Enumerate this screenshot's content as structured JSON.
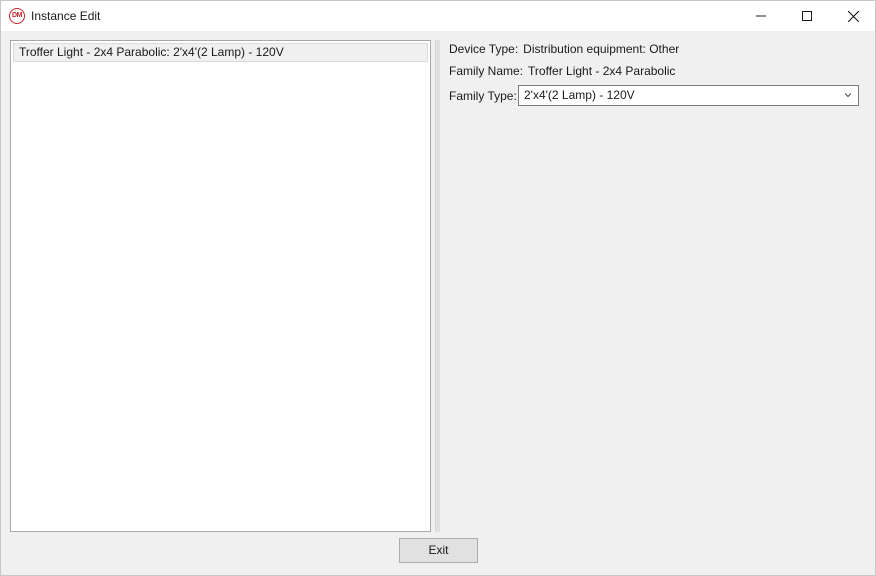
{
  "window": {
    "title": "Instance Edit",
    "app_icon_text": "DM"
  },
  "list": {
    "items": [
      {
        "label": "Troffer Light - 2x4 Parabolic: 2'x4'(2 Lamp) - 120V",
        "selected": true
      }
    ]
  },
  "details": {
    "device_type_label": "Device Type:",
    "device_type_value": "Distribution equipment: Other",
    "family_name_label": "Family Name:",
    "family_name_value": "Troffer Light - 2x4 Parabolic",
    "family_type_label": "Family Type:",
    "family_type_value": "2'x4'(2 Lamp) - 120V"
  },
  "buttons": {
    "exit_label": "Exit"
  },
  "icons": {
    "minimize": "minimize-icon",
    "maximize": "maximize-icon",
    "close": "close-icon",
    "combo": "chevron-down-icon"
  },
  "colors": {
    "app_icon_accent": "#c2262e",
    "window_bg": "#f0f0f0",
    "list_bg": "#ffffff"
  }
}
